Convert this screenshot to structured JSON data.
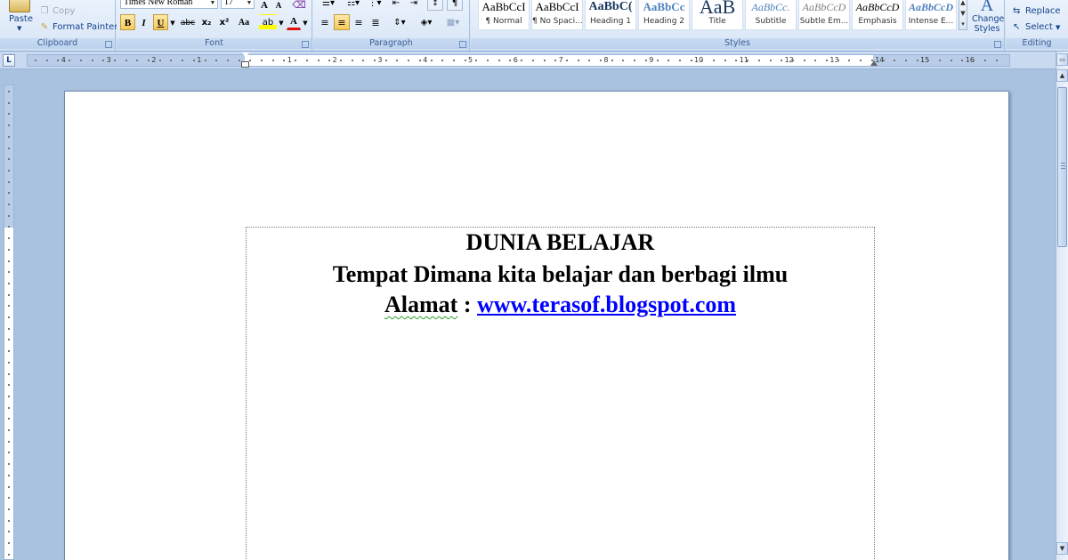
{
  "ribbon": {
    "clipboard": {
      "label": "Clipboard",
      "paste": "Paste",
      "copy": "Copy",
      "format_painter": "Format Painter"
    },
    "font": {
      "label": "Font",
      "font_name": "Times New Roman",
      "font_size": "17",
      "grow": "A",
      "shrink": "A",
      "bold": "B",
      "italic": "I",
      "underline": "U",
      "strike": "abc",
      "subscript": "x₂",
      "superscript": "x²",
      "change_case": "Aa",
      "highlight": "ab",
      "font_color": "A"
    },
    "paragraph": {
      "label": "Paragraph"
    },
    "styles": {
      "label": "Styles",
      "items": [
        {
          "sample": "AaBbCcI",
          "name": "¶ Normal"
        },
        {
          "sample": "AaBbCcI",
          "name": "¶ No Spaci..."
        },
        {
          "sample": "AaBbC(",
          "name": "Heading 1"
        },
        {
          "sample": "AaBbCc",
          "name": "Heading 2"
        },
        {
          "sample": "AaB",
          "name": "Title"
        },
        {
          "sample": "AaBbCc.",
          "name": "Subtitle"
        },
        {
          "sample": "AaBbCcD",
          "name": "Subtle Em..."
        },
        {
          "sample": "AaBbCcD",
          "name": "Emphasis"
        },
        {
          "sample": "AaBbCcD",
          "name": "Intense E..."
        }
      ],
      "change_styles": "Change Styles"
    },
    "editing": {
      "label": "Editing",
      "replace": "Replace",
      "select": "Select"
    }
  },
  "ruler": {
    "tab_selector": "L",
    "numbers": [
      "4",
      "3",
      "2",
      "1",
      "1",
      "2",
      "3",
      "4",
      "5",
      "6",
      "7",
      "8",
      "9",
      "10",
      "11",
      "12",
      "13",
      "14",
      "15",
      "16"
    ]
  },
  "document": {
    "line1": "DUNIA BELAJAR",
    "line2": "Tempat Dimana kita belajar dan berbagi ilmu",
    "line3_label": "Alamat",
    "line3_sep": " : ",
    "line3_link": "www.terasof.blogspot.com"
  },
  "colors": {
    "link": "#0000ff",
    "ribbon_text": "#15428b",
    "active_button": "#f8c95c"
  }
}
